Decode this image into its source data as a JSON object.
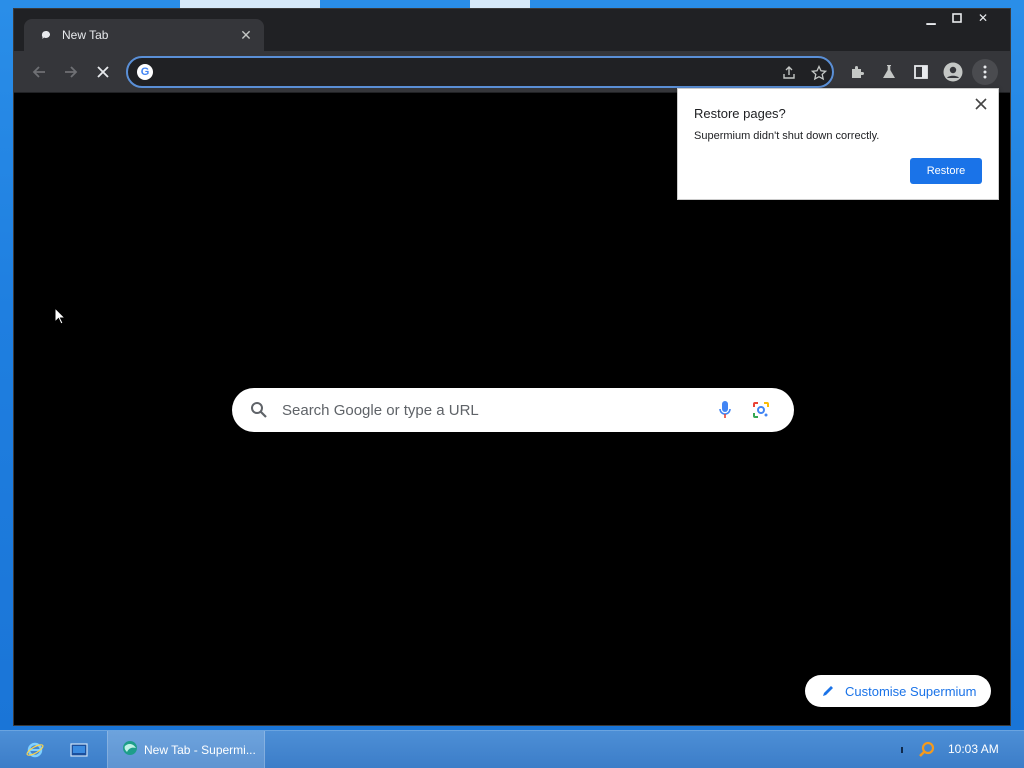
{
  "tab": {
    "title": "New Tab",
    "favicon": "chat-bubble-icon",
    "close_icon": "close-icon"
  },
  "window_controls": {
    "minimize": "minimize-icon",
    "maximize": "maximize-icon",
    "close": "close-icon"
  },
  "toolbar": {
    "back": "back-arrow-icon",
    "forward": "forward-arrow-icon",
    "stop": "stop-icon",
    "omnibox_value": "",
    "omnibox_icon": "G",
    "share": "share-icon",
    "bookmark": "star-icon",
    "extensions": "puzzle-icon",
    "labs": "flask-icon",
    "side_panel": "side-panel-icon",
    "profile": "profile-icon",
    "menu": "kebab-menu-icon"
  },
  "popup": {
    "title": "Restore pages?",
    "message": "Supermium didn't shut down correctly.",
    "restore_label": "Restore"
  },
  "ntp": {
    "search_placeholder": "Search Google or type a URL",
    "customise_label": "Customise Supermium"
  },
  "taskbar": {
    "task_label": "New Tab - Supermi...",
    "clock": "10:03 AM"
  },
  "colors": {
    "accent": "#1a73e8",
    "omnibox_border": "#5a8fd6",
    "window_bg": "#000000",
    "taskbar": "#3c7dc8"
  }
}
